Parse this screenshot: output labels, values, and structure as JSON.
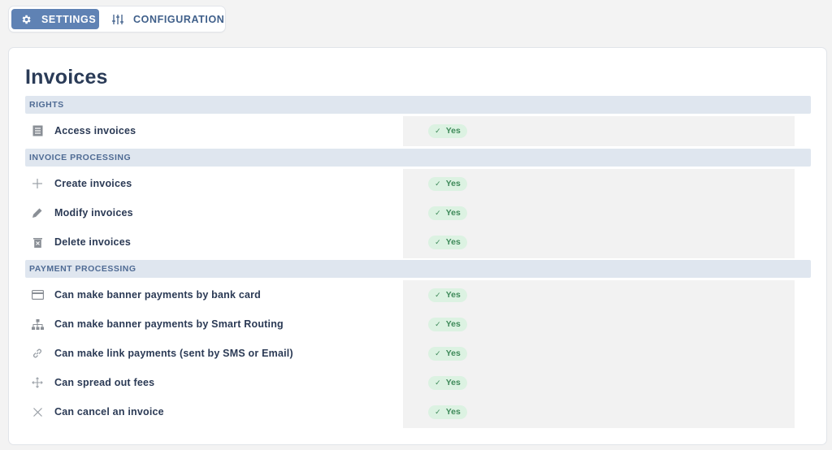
{
  "tabs": [
    {
      "label": "SETTINGS",
      "icon": "gear-icon",
      "active": true
    },
    {
      "label": "CONFIGURATION",
      "icon": "sliders-icon",
      "active": false
    }
  ],
  "card": {
    "title": "Invoices",
    "sections": [
      {
        "title": "RIGHTS",
        "rows": [
          {
            "label": "Access invoices",
            "icon": "list-icon",
            "value": "Yes"
          }
        ]
      },
      {
        "title": "INVOICE PROCESSING",
        "rows": [
          {
            "label": "Create invoices",
            "icon": "plus-icon",
            "value": "Yes"
          },
          {
            "label": "Modify invoices",
            "icon": "pencil-icon",
            "value": "Yes"
          },
          {
            "label": "Delete invoices",
            "icon": "trash-icon",
            "value": "Yes"
          }
        ]
      },
      {
        "title": "PAYMENT PROCESSING",
        "rows": [
          {
            "label": "Can make banner payments by bank card",
            "icon": "card-icon",
            "value": "Yes"
          },
          {
            "label": "Can make banner payments by Smart Routing",
            "icon": "sitemap-icon",
            "value": "Yes"
          },
          {
            "label": "Can make link payments (sent by SMS or Email)",
            "icon": "link-icon",
            "value": "Yes"
          },
          {
            "label": "Can spread out fees",
            "icon": "arrows-icon",
            "value": "Yes"
          },
          {
            "label": "Can cancel an invoice",
            "icon": "close-icon",
            "value": "Yes"
          }
        ]
      }
    ]
  },
  "colors": {
    "accent": "#5f82b4",
    "section_bg": "#dfe6ef",
    "badge_bg": "#dcf2e2",
    "badge_text": "#3f8a5a"
  }
}
